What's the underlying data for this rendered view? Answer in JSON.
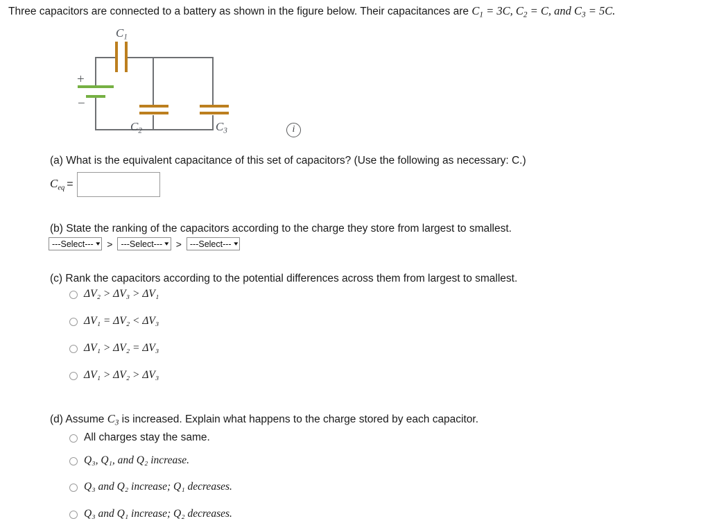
{
  "problem": {
    "statement_prefix": "Three capacitors are connected to a battery as shown in the figure below. Their capacitances are ",
    "c1_symbol": "C",
    "c1_sub": "1",
    "c1_eq": " = 3C, ",
    "c2_symbol": "C",
    "c2_sub": "2",
    "c2_eq": " = C, and ",
    "c3_symbol": "C",
    "c3_sub": "3",
    "c3_eq": " = 5C."
  },
  "figure": {
    "labels": {
      "c1": "C",
      "c1_sub": "1",
      "c2": "C",
      "c2_sub": "2",
      "c3": "C",
      "c3_sub": "3",
      "plus": "+",
      "minus": "−"
    },
    "info_icon": "i",
    "colors": {
      "wire": "#6e7073",
      "capacitor_plate": "#bc7f1f",
      "battery_plate": "#76b043",
      "label": "#4a4f57"
    }
  },
  "parts": {
    "a": {
      "question": "(a) What is the equivalent capacitance of this set of capacitors? (Use the following as necessary: C.)",
      "answer_label": "C",
      "answer_sub": "eq",
      "equals": "=",
      "input_value": "",
      "input_placeholder": ""
    },
    "b": {
      "question": "(b) State the ranking of the capacitors according to the charge they store from largest to smallest.",
      "select_value": "---Select---",
      "chevron": "▾",
      "separator": ">",
      "selects": [
        "---Select---",
        "---Select---",
        "---Select---"
      ]
    },
    "c": {
      "question": "(c) Rank the capacitors according to the potential differences across them from largest to smallest.",
      "options": [
        {
          "id": "c-opt-1",
          "text": "ΔV₂ > ΔV₃ > ΔV₁",
          "selected": false
        },
        {
          "id": "c-opt-2",
          "text": "ΔV₁ = ΔV₂ < ΔV₃",
          "selected": false
        },
        {
          "id": "c-opt-3",
          "text": "ΔV₁ > ΔV₂ = ΔV₃",
          "selected": false
        },
        {
          "id": "c-opt-4",
          "text": "ΔV₁ > ΔV₂ > ΔV₃",
          "selected": false
        }
      ]
    },
    "d": {
      "question_pre": "(d) Assume ",
      "question_var": "C",
      "question_var_sub": "3",
      "question_post": " is increased. Explain what happens to the charge stored by each capacitor.",
      "options": [
        {
          "id": "d-opt-1",
          "text": "All charges stay the same.",
          "selected": false
        },
        {
          "id": "d-opt-2",
          "text": "Q₃, Q₁, and Q₂ increase.",
          "selected": false
        },
        {
          "id": "d-opt-3",
          "text": "Q₃ and Q₂ increase; Q₁ decreases.",
          "selected": false
        },
        {
          "id": "d-opt-4",
          "text": "Q₃ and Q₁ increase; Q₂ decreases.",
          "selected": false
        }
      ]
    }
  }
}
